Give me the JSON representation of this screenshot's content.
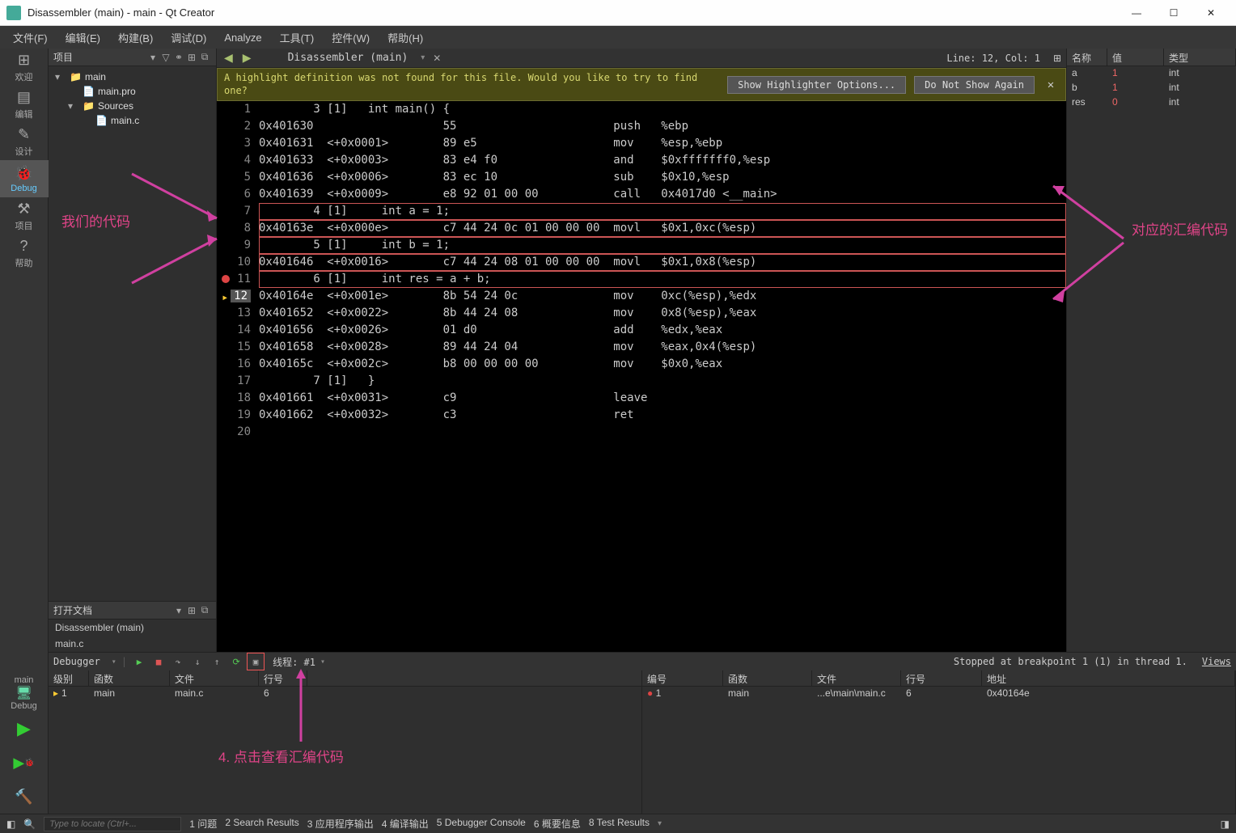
{
  "window_title": "Disassembler (main) - main - Qt Creator",
  "menubar": [
    "文件(F)",
    "编辑(E)",
    "构建(B)",
    "调试(D)",
    "Analyze",
    "工具(T)",
    "控件(W)",
    "帮助(H)"
  ],
  "leftbar": {
    "items": [
      {
        "icon": "⊞",
        "label": "欢迎"
      },
      {
        "icon": "▤",
        "label": "编辑"
      },
      {
        "icon": "✎",
        "label": "设计"
      },
      {
        "icon": "🐞",
        "label": "Debug",
        "active": true
      },
      {
        "icon": "⚒",
        "label": "项目"
      },
      {
        "icon": "?",
        "label": "帮助"
      }
    ],
    "run_target": "main",
    "run_mode": "Debug"
  },
  "proj_panel": {
    "title": "项目",
    "tree": [
      {
        "indent": 0,
        "exp": "▾",
        "icon": "📁",
        "label": "main"
      },
      {
        "indent": 1,
        "exp": "",
        "icon": "📄",
        "label": "main.pro"
      },
      {
        "indent": 1,
        "exp": "▾",
        "icon": "📁",
        "label": "Sources"
      },
      {
        "indent": 2,
        "exp": "",
        "icon": "📄",
        "label": "main.c"
      }
    ],
    "open_docs_title": "打开文档",
    "open_docs": [
      "Disassembler (main)",
      "main.c"
    ]
  },
  "editor": {
    "tab_name": "Disassembler (main)",
    "line_col": "Line: 12, Col: 1",
    "warn_text": "A highlight definition was not found for this file. Would you like to try to find one?",
    "warn_btn1": "Show Highlighter Options...",
    "warn_btn2": "Do Not Show Again",
    "lines": [
      {
        "n": 1,
        "text": "        3 [1]   int main() {"
      },
      {
        "n": 2,
        "text": "0x401630                   55                       push   %ebp"
      },
      {
        "n": 3,
        "text": "0x401631  <+0x0001>        89 e5                    mov    %esp,%ebp"
      },
      {
        "n": 4,
        "text": "0x401633  <+0x0003>        83 e4 f0                 and    $0xfffffff0,%esp"
      },
      {
        "n": 5,
        "text": "0x401636  <+0x0006>        83 ec 10                 sub    $0x10,%esp"
      },
      {
        "n": 6,
        "text": "0x401639  <+0x0009>        e8 92 01 00 00           call   0x4017d0 <__main>"
      },
      {
        "n": 7,
        "text": "        4 [1]     int a = 1;",
        "red": true
      },
      {
        "n": 8,
        "text": "0x40163e  <+0x000e>        c7 44 24 0c 01 00 00 00  movl   $0x1,0xc(%esp)",
        "red": true
      },
      {
        "n": 9,
        "text": "        5 [1]     int b = 1;",
        "red": true
      },
      {
        "n": 10,
        "text": "0x401646  <+0x0016>        c7 44 24 08 01 00 00 00  movl   $0x1,0x8(%esp)",
        "red": true
      },
      {
        "n": 11,
        "text": "        6 [1]     int res = a + b;",
        "red": true,
        "bp": true
      },
      {
        "n": 12,
        "text": "0x40164e  <+0x001e>        8b 54 24 0c              mov    0xc(%esp),%edx",
        "cur": true
      },
      {
        "n": 13,
        "text": "0x401652  <+0x0022>        8b 44 24 08              mov    0x8(%esp),%eax"
      },
      {
        "n": 14,
        "text": "0x401656  <+0x0026>        01 d0                    add    %edx,%eax"
      },
      {
        "n": 15,
        "text": "0x401658  <+0x0028>        89 44 24 04              mov    %eax,0x4(%esp)"
      },
      {
        "n": 16,
        "text": "0x40165c  <+0x002c>        b8 00 00 00 00           mov    $0x0,%eax"
      },
      {
        "n": 17,
        "text": "        7 [1]   }"
      },
      {
        "n": 18,
        "text": "0x401661  <+0x0031>        c9                       leave"
      },
      {
        "n": 19,
        "text": "0x401662  <+0x0032>        c3                       ret"
      },
      {
        "n": 20,
        "text": ""
      }
    ]
  },
  "vars_panel": {
    "cols": [
      "名称",
      "值",
      "类型"
    ],
    "rows": [
      {
        "name": "a",
        "val": "1",
        "type": "int",
        "red": true
      },
      {
        "name": "b",
        "val": "1",
        "type": "int",
        "red": true
      },
      {
        "name": "res",
        "val": "0",
        "type": "int",
        "red": true
      }
    ]
  },
  "bottom": {
    "debugger_label": "Debugger",
    "thread_label": "线程: #1",
    "status": "Stopped at breakpoint 1 (1) in thread 1.",
    "views": "Views",
    "stack1_cols": [
      "级别",
      "函数",
      "文件",
      "行号"
    ],
    "stack1_row": {
      "lvl": "1",
      "fn": "main",
      "file": "main.c",
      "ln": "6"
    },
    "stack2_cols": [
      "编号",
      "函数",
      "文件",
      "行号",
      "地址"
    ],
    "stack2_row": {
      "num": "1",
      "fn": "main",
      "file": "...e\\main\\main.c",
      "ln": "6",
      "addr": "0x40164e"
    }
  },
  "statusbar": {
    "locator_placeholder": "Type to locate (Ctrl+...",
    "tabs": [
      "1 问题",
      "2 Search Results",
      "3 应用程序输出",
      "4 编译输出",
      "5 Debugger Console",
      "6 概要信息",
      "8 Test Results"
    ]
  },
  "annotations": {
    "left": "我们的代码",
    "right": "对应的汇编代码",
    "bottom": "4. 点击查看汇编代码"
  }
}
